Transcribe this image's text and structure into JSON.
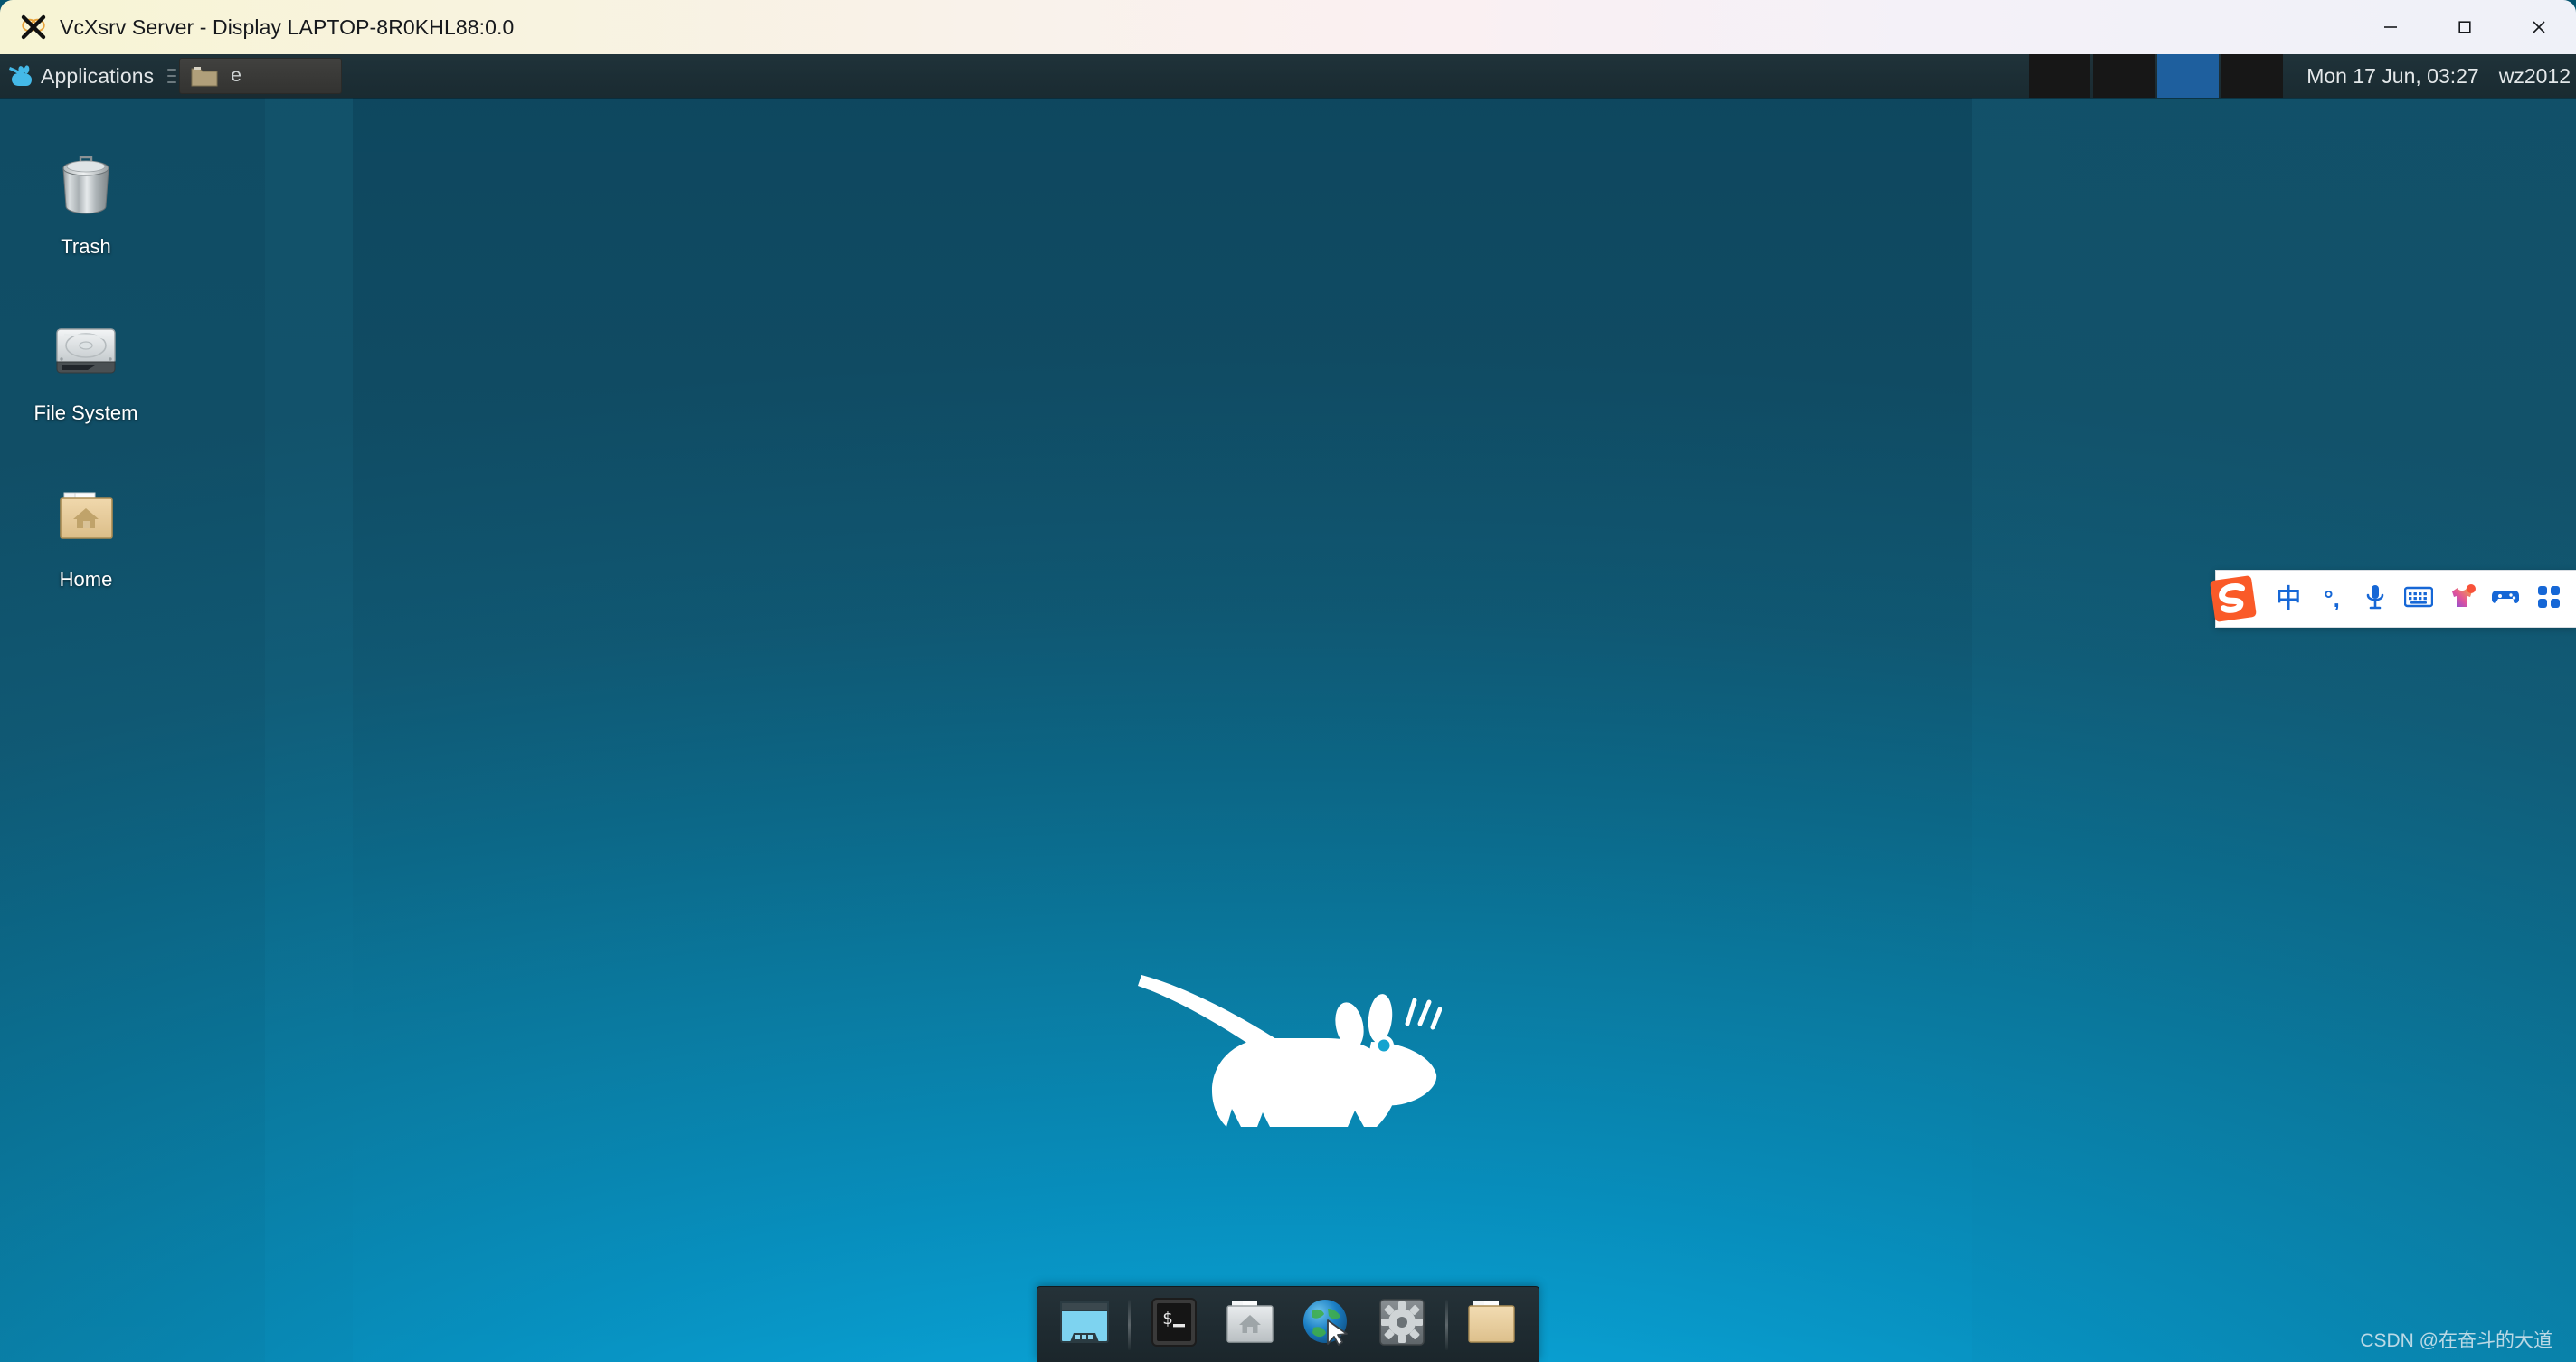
{
  "window": {
    "title": "VcXsrv Server - Display LAPTOP-8R0KHL88:0.0",
    "logo_icon": "vcxsrv-x-icon",
    "controls": [
      {
        "name": "minimize-button",
        "icon": "minimize-icon",
        "label": "—"
      },
      {
        "name": "maximize-button",
        "icon": "maximize-icon",
        "label": "□"
      },
      {
        "name": "close-button",
        "icon": "close-icon",
        "label": "✕"
      }
    ]
  },
  "panel": {
    "applications_label": "Applications",
    "applications_icon": "xfce-mouse-icon",
    "handle_icon": "panel-handle-icon",
    "tasks": [
      {
        "label": "e",
        "icon": "folder-icon"
      }
    ],
    "workspaces": [
      {
        "name": "workspace-1",
        "active": false
      },
      {
        "name": "workspace-2",
        "active": false
      },
      {
        "name": "workspace-3",
        "active": true
      },
      {
        "name": "workspace-4",
        "active": false
      }
    ],
    "clock": "Mon 17 Jun, 03:27",
    "user": "wz2012",
    "colors": {
      "background": "#1c2e35",
      "active_workspace": "#1e5f9e",
      "text": "#e4e8ea"
    }
  },
  "desktop": {
    "icons": [
      {
        "label": "Trash",
        "icon": "trash-icon"
      },
      {
        "label": "File System",
        "icon": "harddisk-icon"
      },
      {
        "label": "Home",
        "icon": "home-folder-icon"
      }
    ],
    "wallpaper_logo": "xfce-mouse-logo",
    "colors": {
      "top": "#14566f",
      "bottom": "#12b3e3"
    }
  },
  "sogou": {
    "logo_icon": "sogou-s-logo",
    "buttons": [
      {
        "name": "input-mode-chinese",
        "icon": "chinese-character-icon",
        "label": "中"
      },
      {
        "name": "punctuation-mode",
        "icon": "punctuation-icon",
        "label": "°,"
      },
      {
        "name": "voice-input",
        "icon": "microphone-icon",
        "label": ""
      },
      {
        "name": "soft-keyboard",
        "icon": "keyboard-icon",
        "label": ""
      },
      {
        "name": "skin-center",
        "icon": "skin-shirt-icon",
        "label": ""
      },
      {
        "name": "game-mode",
        "icon": "game-controller-icon",
        "label": ""
      },
      {
        "name": "menu-grid",
        "icon": "grid-menu-icon",
        "label": ""
      }
    ],
    "colors": {
      "accent": "#1667d6",
      "logo": "#fa5a28"
    }
  },
  "dock": {
    "items": [
      {
        "name": "show-desktop-button",
        "icon": "show-desktop-icon"
      },
      {
        "name": "dock-separator-1",
        "icon": "separator-icon"
      },
      {
        "name": "terminal-button",
        "icon": "terminal-icon"
      },
      {
        "name": "home-button",
        "icon": "home-folder-grey-icon"
      },
      {
        "name": "web-browser-button",
        "icon": "globe-cursor-icon"
      },
      {
        "name": "settings-button",
        "icon": "gear-icon"
      },
      {
        "name": "dock-separator-2",
        "icon": "separator-icon"
      },
      {
        "name": "file-manager-button",
        "icon": "folder-tan-icon"
      }
    ]
  },
  "watermark": {
    "text": "CSDN @在奋斗的大道"
  }
}
